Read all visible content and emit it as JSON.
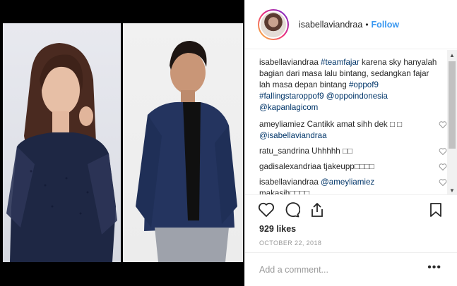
{
  "header": {
    "username": "isabellaviandraa",
    "separator": "•",
    "follow_label": "Follow"
  },
  "caption": {
    "username": "isabellaviandraa",
    "hashtag_team": "#teamfajar",
    "text_1": " karena sky hanyalah bagian dari masa lalu bintang, sedangkan fajar lah masa depan bintang ",
    "hashtag_oppo": "#oppof9",
    "hashtag_falling": "#fallingstaroppof9",
    "mention_oppo": "@oppoindonesia",
    "mention_kapan": "@kapanlagicom"
  },
  "comments": [
    {
      "username": "ameyliamiez",
      "text": " Cantikk amat sihh dek ",
      "box": "□ □",
      "mention": "@isabellaviandraa"
    },
    {
      "username": "ratu_sandrina",
      "text": " Uhhhhh □□"
    },
    {
      "username": "gadisalexandriaa",
      "text": " tjakeupp□□□□"
    },
    {
      "username": "isabellaviandraa",
      "mention": "@ameyliamiez",
      "text": "makasih□□□□"
    }
  ],
  "likes": "929 likes",
  "date": "OCTOBER 22, 2018",
  "add_comment": {
    "placeholder": "Add a comment..."
  },
  "more_label": "•••",
  "icons": {
    "like": "heart-icon",
    "comment": "comment-bubble-icon",
    "share": "share-icon",
    "save": "bookmark-icon",
    "tag": "user-tag-icon"
  }
}
